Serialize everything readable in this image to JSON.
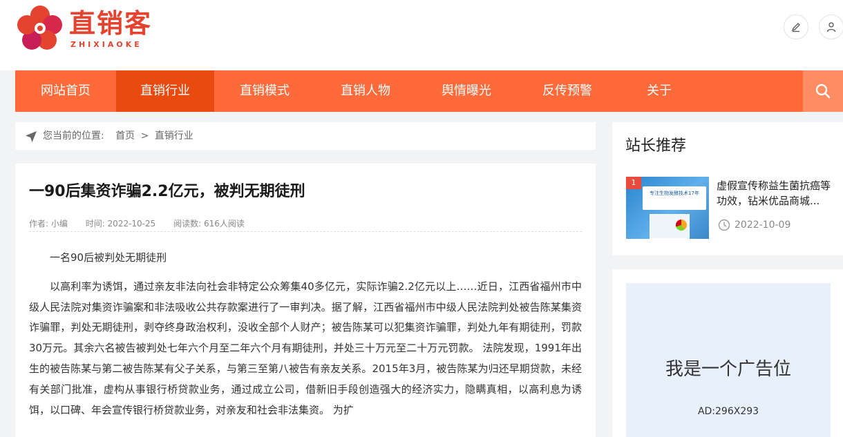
{
  "header": {
    "logo_text": "直销客",
    "logo_sub": "ZHIXIAOKE"
  },
  "nav": {
    "items": [
      {
        "label": "网站首页",
        "active": false
      },
      {
        "label": "直销行业",
        "active": true
      },
      {
        "label": "直销模式",
        "active": false
      },
      {
        "label": "直销人物",
        "active": false
      },
      {
        "label": "舆情曝光",
        "active": false
      },
      {
        "label": "反传预警",
        "active": false
      },
      {
        "label": "关于",
        "active": false
      }
    ]
  },
  "breadcrumb": {
    "prefix": "您当前的位置:",
    "home": "首页",
    "separator": ">",
    "current": "直销行业"
  },
  "article": {
    "title": "一90后集资诈骗2.2亿元，被判无期徒刑",
    "author": "作者: 小编",
    "time": "时间: 2022-10-25",
    "reads": "阅读数: 616人阅读",
    "paragraphs": [
      "一名90后被判处无期徒刑",
      "以高利率为诱饵，通过亲友非法向社会非特定公众筹集40多亿元，实际诈骗2.2亿元以上……近日，江西省福州市中级人民法院对集资诈骗案和非法吸收公共存款案进行了一审判决。据了解，江西省福州市中级人民法院判处被告陈某集资诈骗罪，判处无期徒刑，剥夺终身政治权利，没收全部个人财产；被告陈某可以犯集资诈骗罪，判处九年有期徒刑，罚款30万元。其余六名被告被判处七年六个月至二年六个月有期徒刑，并处三十万元至二十万元罚款。 法院发现，1991年出生的被告陈某与第二被告陈某有父子关系，与第三至第八被告有亲友关系。2015年3月，被告陈某为归还早期贷款，未经有关部门批准，虚构从事银行桥贷款业务，通过成立公司，借新旧手段创造强大的经济实力，隐瞒真相，以高利息为诱饵，以口碑、年会宣传银行桥贷款业务，对亲友和社会非法集资。 为扩"
    ]
  },
  "sidebar": {
    "title": "站长推荐",
    "recommend": {
      "rank": "1",
      "thumb_caption": "专注生物发酵技术17年",
      "title": "虚假宣传称益生菌抗癌等功效，钻米优品商城...",
      "date": "2022-10-09"
    },
    "ad": {
      "text": "我是一个广告位",
      "size": "AD:296X293"
    }
  },
  "colors": {
    "brand": "#e4432f",
    "nav_bg": "#ff6a3a",
    "nav_active": "#e84a10"
  }
}
